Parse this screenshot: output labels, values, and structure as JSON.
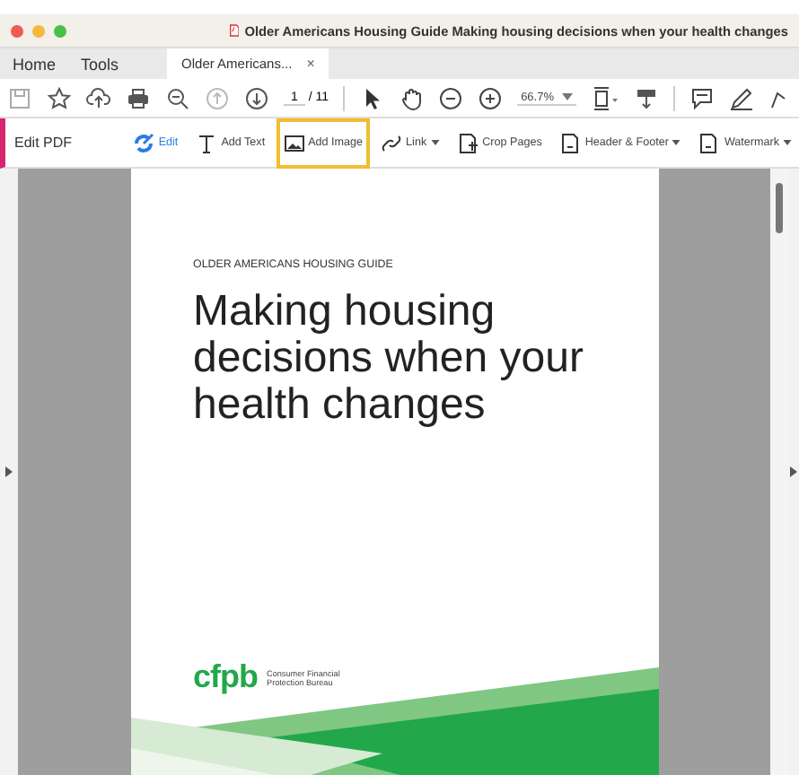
{
  "window": {
    "title": "Older Americans Housing Guide Making housing decisions when your health changes"
  },
  "tabs": [
    {
      "label": "Home",
      "selected": false,
      "kind": "nav"
    },
    {
      "label": "Tools",
      "selected": false,
      "kind": "nav"
    },
    {
      "label": "Older Americans...",
      "selected": true,
      "kind": "document",
      "close": "×"
    }
  ],
  "toolbar": {
    "page": "1",
    "page_total": "/ 11",
    "zoom": "66.7%"
  },
  "edit_bar": {
    "title": "Edit PDF",
    "tools": [
      {
        "label": "Edit",
        "selected": true,
        "dropdown": false,
        "highlighted": false
      },
      {
        "label": "Add Text",
        "selected": false,
        "dropdown": false,
        "highlighted": false
      },
      {
        "label": "Add Image",
        "selected": false,
        "dropdown": false,
        "highlighted": true
      },
      {
        "label": "Link",
        "selected": false,
        "dropdown": true,
        "highlighted": false
      },
      {
        "label": "Crop Pages",
        "selected": false,
        "dropdown": false,
        "highlighted": false
      },
      {
        "label": "Header & Footer",
        "selected": false,
        "dropdown": true,
        "highlighted": false
      },
      {
        "label": "Watermark",
        "selected": false,
        "dropdown": true,
        "highlighted": false
      }
    ]
  },
  "document": {
    "eyebrow": "OLDER AMERICANS HOUSING GUIDE",
    "heading": "Making housing decisions when your health changes",
    "logo": "cfpb",
    "agency_lines": [
      "Consumer Financial",
      "Protection Bureau"
    ]
  }
}
